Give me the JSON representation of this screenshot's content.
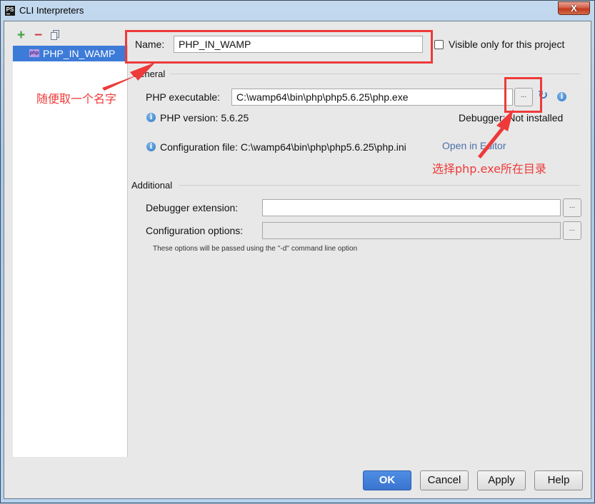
{
  "window": {
    "title": "CLI Interpreters",
    "app_icon": "PS",
    "close_label": "X"
  },
  "toolbar": {
    "add_icon": "+",
    "remove_icon": "−"
  },
  "interpreters": [
    {
      "label": "PHP_IN_WAMP",
      "icon": "php",
      "selected": true
    }
  ],
  "form": {
    "name_label": "Name:",
    "name_value": "PHP_IN_WAMP",
    "visible_only_label": "Visible only for this project",
    "visible_only_checked": false,
    "general": {
      "title": "General",
      "php_executable_label": "PHP executable:",
      "php_executable_value": "C:\\wamp64\\bin\\php\\php5.6.25\\php.exe",
      "browse_label": "...",
      "php_version": "PHP version: 5.6.25",
      "debugger_status": "Debugger: Not installed",
      "config_file": "Configuration file: C:\\wamp64\\bin\\php\\php5.6.25\\php.ini",
      "open_in_editor": "Open in Editor"
    },
    "additional": {
      "title": "Additional",
      "debugger_extension_label": "Debugger extension:",
      "debugger_extension_value": "",
      "configuration_options_label": "Configuration options:",
      "configuration_options_value": "",
      "browse_label": "...",
      "hint": "These options will be passed using the ''-d'' command line option"
    }
  },
  "buttons": {
    "ok": "OK",
    "cancel": "Cancel",
    "apply": "Apply",
    "help": "Help"
  },
  "annotations": {
    "name_note": "随便取一个名字",
    "exe_note": "选择php.exe所在目录",
    "color": "#ee3a3a"
  }
}
